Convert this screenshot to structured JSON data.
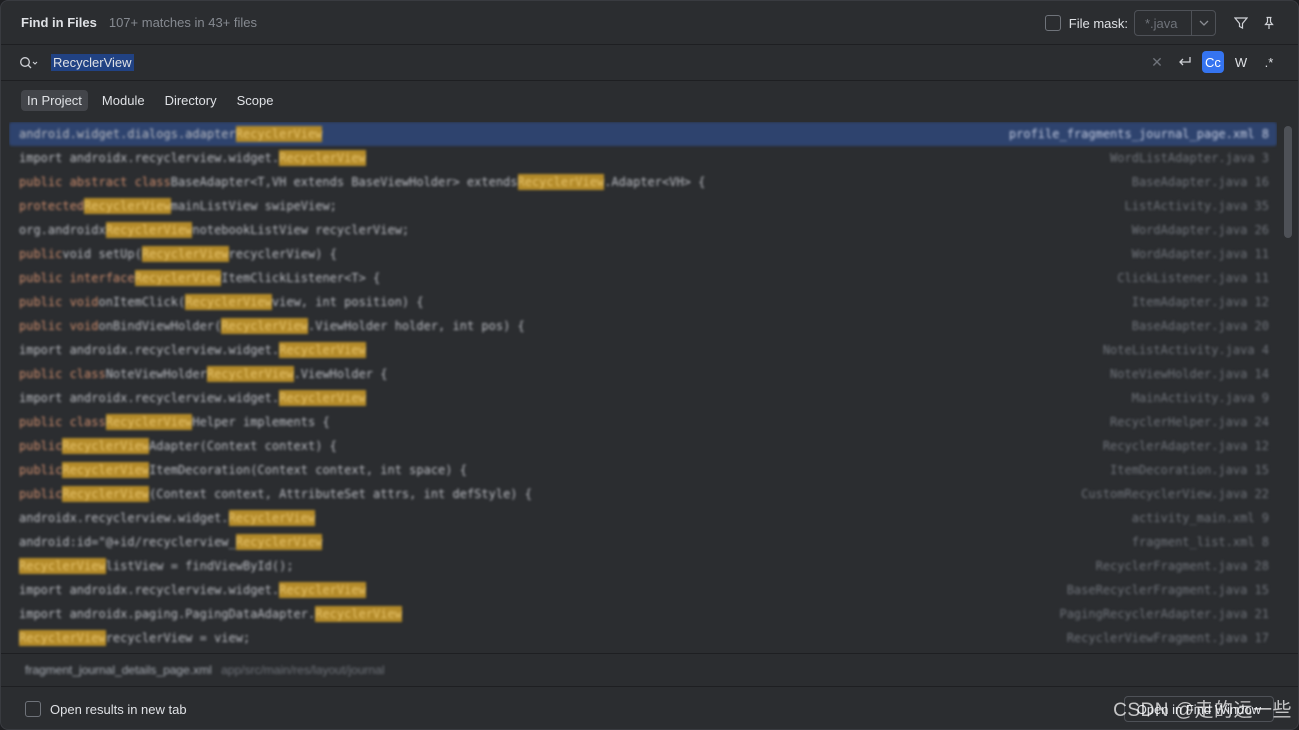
{
  "header": {
    "title": "Find in Files",
    "matches": "107+ matches in 43+ files",
    "file_mask_label": "File mask:",
    "file_mask_value": "*.java"
  },
  "search": {
    "query": "RecyclerView",
    "case_label": "Cc",
    "words_label": "W",
    "regex_label": ".*"
  },
  "scopes": [
    {
      "label": "In Project",
      "selected": true
    },
    {
      "label": "Module",
      "selected": false
    },
    {
      "label": "Directory",
      "selected": false
    },
    {
      "label": "Scope",
      "selected": false
    }
  ],
  "results": [
    {
      "pre": "android.widget.dialogs.adapter ",
      "kw": "",
      "mid": "",
      "hl": "RecyclerView",
      "post": "",
      "file": "profile_fragments_journal_page.xml 8",
      "selected": true
    },
    {
      "pre": "import androidx.recyclerview.widget.",
      "kw": "",
      "mid": "",
      "hl": "RecyclerView",
      "post": "",
      "file": "WordListAdapter.java 3"
    },
    {
      "pre": "",
      "kw": "public abstract class ",
      "mid": "BaseAdapter<T,VH extends BaseViewHolder> extends ",
      "hl": "RecyclerView",
      "post": ".Adapter<VH> {",
      "file": "BaseAdapter.java 16"
    },
    {
      "pre": "",
      "kw": "protected ",
      "mid": "",
      "hl": "RecyclerView",
      "post": "mainListView swipeView;",
      "file": "ListActivity.java 35"
    },
    {
      "pre": "",
      "kw": "",
      "mid": "org.androidx ",
      "hl": "RecyclerView",
      "post": "notebookListView recyclerView;",
      "file": "WordAdapter.java 26"
    },
    {
      "pre": "",
      "kw": "public ",
      "mid": "void setUp(",
      "hl": "RecyclerView",
      "post": " recyclerView) {",
      "file": "WordAdapter.java 11"
    },
    {
      "pre": "",
      "kw": "public interface ",
      "mid": "",
      "hl": "RecyclerView",
      "post": "ItemClickListener<T> {",
      "file": "ClickListener.java 11"
    },
    {
      "pre": "",
      "kw": "public void ",
      "mid": "onItemClick(",
      "hl": "RecyclerView",
      "post": " view, int position) {",
      "file": "ItemAdapter.java 12"
    },
    {
      "pre": "",
      "kw": "public void ",
      "mid": "onBindViewHolder(",
      "hl": "RecyclerView",
      "post": ".ViewHolder holder, int pos) {",
      "file": "BaseAdapter.java 20"
    },
    {
      "pre": "import androidx.recyclerview.widget.",
      "kw": "",
      "mid": "",
      "hl": "RecyclerView",
      "post": "",
      "file": "NoteListActivity.java 4"
    },
    {
      "pre": "",
      "kw": "public class ",
      "mid": "NoteViewHolder ",
      "hl": "RecyclerView",
      "post": ".ViewHolder {",
      "file": "NoteViewHolder.java 14"
    },
    {
      "pre": "import androidx.recyclerview.widget.",
      "kw": "",
      "mid": "",
      "hl": "RecyclerView",
      "post": "",
      "file": "MainActivity.java 9"
    },
    {
      "pre": "",
      "kw": "public class ",
      "mid": "",
      "hl": "RecyclerView",
      "post": "Helper implements {",
      "file": "RecyclerHelper.java 24"
    },
    {
      "pre": "",
      "kw": "public ",
      "mid": "",
      "hl": "RecyclerView",
      "post": "Adapter(Context context) {",
      "file": "RecyclerAdapter.java 12"
    },
    {
      "pre": "",
      "kw": "public ",
      "mid": "",
      "hl": "RecyclerView",
      "post": "ItemDecoration(Context context, int space) {",
      "file": "ItemDecoration.java 15"
    },
    {
      "pre": "",
      "kw": "public ",
      "mid": "",
      "hl": "RecyclerView",
      "post": "(Context context, AttributeSet attrs, int defStyle) {",
      "file": "CustomRecyclerView.java 22"
    },
    {
      "pre": "androidx.recyclerview.widget.",
      "kw": "",
      "mid": "",
      "hl": "RecyclerView",
      "post": "",
      "file": "activity_main.xml 9"
    },
    {
      "pre": "android:id=\"@+id/recyclerview_",
      "kw": "",
      "mid": "",
      "hl": "RecyclerView",
      "post": "",
      "file": "fragment_list.xml 8"
    },
    {
      "pre": "",
      "kw": "",
      "mid": "",
      "hl": "RecyclerView",
      "post": " listView = findViewById();",
      "file": "RecyclerFragment.java 28"
    },
    {
      "pre": "import androidx.recyclerview.widget.",
      "kw": "",
      "mid": "",
      "hl": "RecyclerView",
      "post": "",
      "file": "BaseRecyclerFragment.java 15"
    },
    {
      "pre": "import androidx.paging.PagingDataAdapter.",
      "kw": "",
      "mid": "",
      "hl": "RecyclerView",
      "post": "",
      "file": "PagingRecyclerAdapter.java 21"
    },
    {
      "pre": "",
      "kw": "",
      "mid": "",
      "hl": "RecyclerView",
      "post": " recyclerView = view;",
      "file": "RecyclerViewFragment.java 17"
    }
  ],
  "preview": {
    "file": "fragment_journal_details_page.xml",
    "path": "app/src/main/res/layout/journal"
  },
  "footer": {
    "open_new_tab_label": "Open results in new tab",
    "open_window_label": "Open in Find Window"
  },
  "watermark": "CSDN @走的远一些"
}
